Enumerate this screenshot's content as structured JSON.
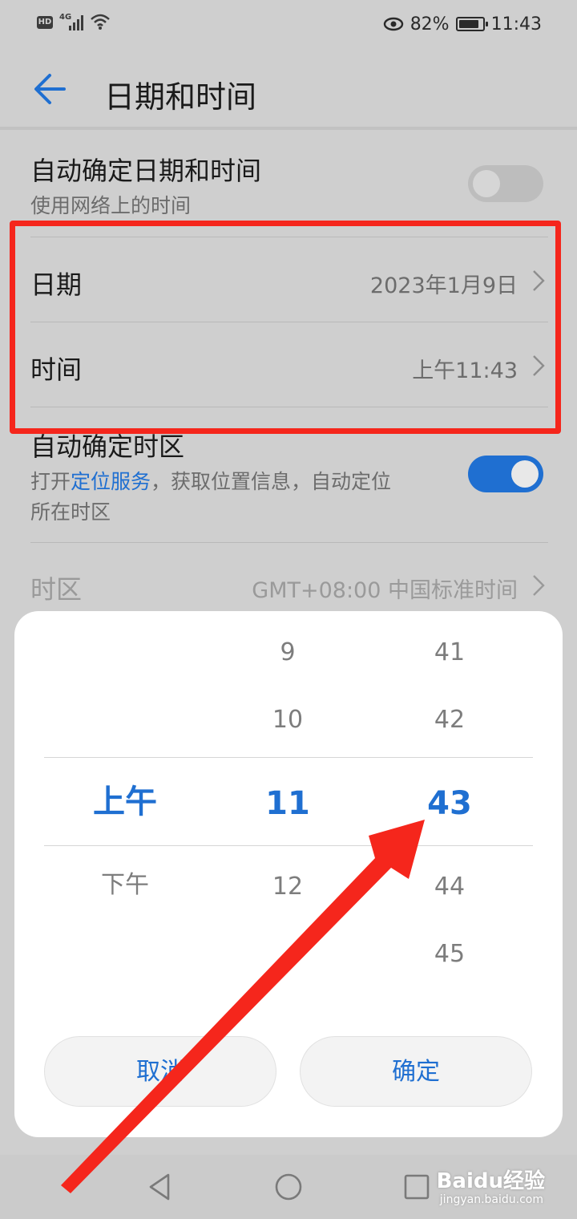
{
  "status_bar": {
    "hd": "HD",
    "network": "4G",
    "battery_percent": "82%",
    "battery_level": 0.82,
    "time": "11:43"
  },
  "header": {
    "title": "日期和时间"
  },
  "settings": {
    "auto_datetime": {
      "title": "自动确定日期和时间",
      "subtitle": "使用网络上的时间",
      "enabled": false
    },
    "date": {
      "label": "日期",
      "value": "2023年1月9日"
    },
    "time": {
      "label": "时间",
      "value": "上午11:43"
    },
    "auto_timezone": {
      "title": "自动确定时区",
      "subtitle_pre": "打开",
      "subtitle_link": "定位服务",
      "subtitle_post": "，获取位置信息，自动定位",
      "subtitle_line2": "所在时区",
      "enabled": true
    },
    "timezone": {
      "label": "时区",
      "value": "GMT+08:00 中国标准时间"
    }
  },
  "picker": {
    "ampm": {
      "selected": "上午",
      "below": "下午"
    },
    "hours": {
      "above2": "9",
      "above1": "10",
      "selected": "11",
      "below1": "12"
    },
    "minutes": {
      "above2": "41",
      "above1": "42",
      "selected": "43",
      "below1": "44",
      "below2": "45"
    },
    "cancel_label": "取消",
    "confirm_label": "确定"
  },
  "watermark": {
    "brand": "Baidu经验",
    "url": "jingyan.baidu.com"
  },
  "colors": {
    "accent": "#1f6fd1",
    "annotation": "#f5261c"
  },
  "icons": {
    "back": "arrow-left-icon",
    "chevron": "chevron-right-icon",
    "nav_back": "triangle-back-icon",
    "nav_home": "circle-home-icon",
    "nav_recent": "square-recent-icon"
  }
}
